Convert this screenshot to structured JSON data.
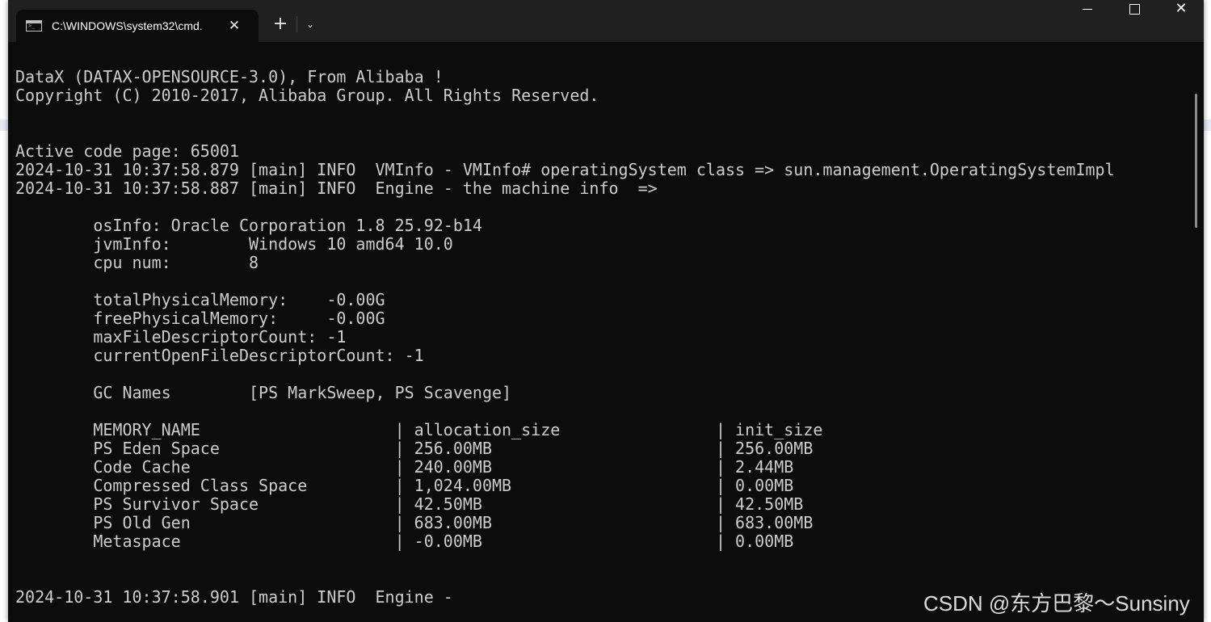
{
  "window": {
    "tab_title": "C:\\WINDOWS\\system32\\cmd.",
    "tab_close": "✕",
    "new_tab": "+",
    "dropdown": "⌄",
    "close": "✕"
  },
  "terminal": {
    "lines": [
      "DataX (DATAX-OPENSOURCE-3.0), From Alibaba !",
      "Copyright (C) 2010-2017, Alibaba Group. All Rights Reserved.",
      "",
      "",
      "Active code page: 65001",
      "2024-10-31 10:37:58.879 [main] INFO  VMInfo - VMInfo# operatingSystem class => sun.management.OperatingSystemImpl",
      "2024-10-31 10:37:58.887 [main] INFO  Engine - the machine info  =>",
      "",
      "        osInfo: Oracle Corporation 1.8 25.92-b14",
      "        jvmInfo:        Windows 10 amd64 10.0",
      "        cpu num:        8",
      "",
      "        totalPhysicalMemory:    -0.00G",
      "        freePhysicalMemory:     -0.00G",
      "        maxFileDescriptorCount: -1",
      "        currentOpenFileDescriptorCount: -1",
      "",
      "        GC Names        [PS MarkSweep, PS Scavenge]",
      "",
      "        MEMORY_NAME                    | allocation_size                | init_size",
      "        PS Eden Space                  | 256.00MB                       | 256.00MB",
      "        Code Cache                     | 240.00MB                       | 2.44MB",
      "        Compressed Class Space         | 1,024.00MB                     | 0.00MB",
      "        PS Survivor Space              | 42.50MB                        | 42.50MB",
      "        PS Old Gen                     | 683.00MB                       | 683.00MB",
      "        Metaspace                      | -0.00MB                        | 0.00MB",
      "",
      "",
      "2024-10-31 10:37:58.901 [main] INFO  Engine -"
    ]
  },
  "watermark": "CSDN @东方巴黎～Sunsiny"
}
